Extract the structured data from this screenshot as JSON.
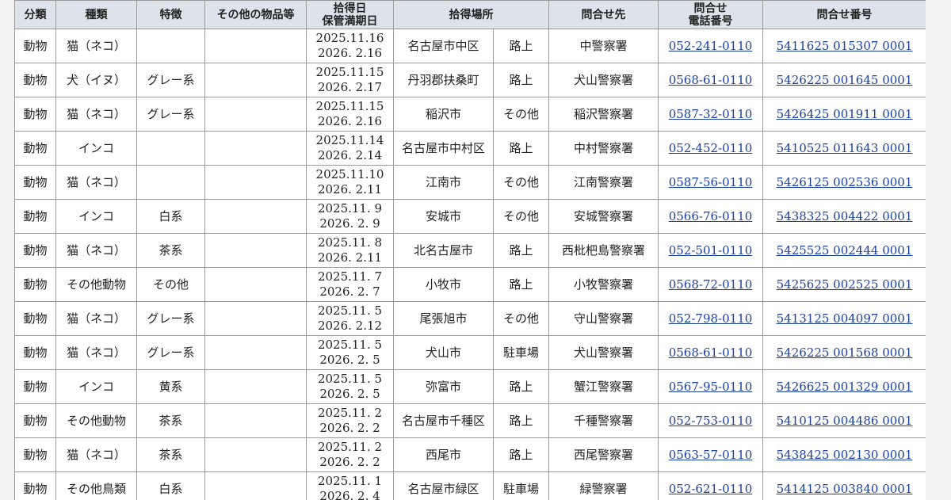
{
  "table": {
    "headers": {
      "category": "分類",
      "kind": "種類",
      "feature": "特徴",
      "other_items": "その他の物品等",
      "date_line1": "拾得日",
      "date_line2": "保管満期日",
      "place": "拾得場所",
      "contact": "問合せ先",
      "phone_line1": "問合せ",
      "phone_line2": "電話番号",
      "inquiry_no": "問合せ番号"
    },
    "rows": [
      {
        "category": "動物",
        "kind": "猫（ネコ）",
        "feature": "",
        "other": "",
        "found": "2025.11.16",
        "expiry": "2026. 2.16",
        "city": "名古屋市中区",
        "spot": "路上",
        "contact": "中警察署",
        "phone": "052-241-0110",
        "inquiry": "5411625 015307 0001"
      },
      {
        "category": "動物",
        "kind": "犬（イヌ）",
        "feature": "グレー系",
        "other": "",
        "found": "2025.11.15",
        "expiry": "2026. 2.17",
        "city": "丹羽郡扶桑町",
        "spot": "路上",
        "contact": "犬山警察署",
        "phone": "0568-61-0110",
        "inquiry": "5426225 001645 0001"
      },
      {
        "category": "動物",
        "kind": "猫（ネコ）",
        "feature": "グレー系",
        "other": "",
        "found": "2025.11.15",
        "expiry": "2026. 2.16",
        "city": "稲沢市",
        "spot": "その他",
        "contact": "稲沢警察署",
        "phone": "0587-32-0110",
        "inquiry": "5426425 001911 0001"
      },
      {
        "category": "動物",
        "kind": "インコ",
        "feature": "",
        "other": "",
        "found": "2025.11.14",
        "expiry": "2026. 2.14",
        "city": "名古屋市中村区",
        "spot": "路上",
        "contact": "中村警察署",
        "phone": "052-452-0110",
        "inquiry": "5410525 011643 0001"
      },
      {
        "category": "動物",
        "kind": "猫（ネコ）",
        "feature": "",
        "other": "",
        "found": "2025.11.10",
        "expiry": "2026. 2.11",
        "city": "江南市",
        "spot": "その他",
        "contact": "江南警察署",
        "phone": "0587-56-0110",
        "inquiry": "5426125 002536 0001"
      },
      {
        "category": "動物",
        "kind": "インコ",
        "feature": "白系",
        "other": "",
        "found": "2025.11. 9",
        "expiry": "2026. 2. 9",
        "city": "安城市",
        "spot": "その他",
        "contact": "安城警察署",
        "phone": "0566-76-0110",
        "inquiry": "5438325 004422 0001"
      },
      {
        "category": "動物",
        "kind": "猫（ネコ）",
        "feature": "茶系",
        "other": "",
        "found": "2025.11. 8",
        "expiry": "2026. 2.11",
        "city": "北名古屋市",
        "spot": "路上",
        "contact": "西枇杷島警察署",
        "phone": "052-501-0110",
        "inquiry": "5425525 002444 0001"
      },
      {
        "category": "動物",
        "kind": "その他動物",
        "feature": "その他",
        "other": "",
        "found": "2025.11. 7",
        "expiry": "2026. 2. 7",
        "city": "小牧市",
        "spot": "路上",
        "contact": "小牧警察署",
        "phone": "0568-72-0110",
        "inquiry": "5425625 002525 0001"
      },
      {
        "category": "動物",
        "kind": "猫（ネコ）",
        "feature": "グレー系",
        "other": "",
        "found": "2025.11. 5",
        "expiry": "2026. 2.12",
        "city": "尾張旭市",
        "spot": "その他",
        "contact": "守山警察署",
        "phone": "052-798-0110",
        "inquiry": "5413125 004097 0001"
      },
      {
        "category": "動物",
        "kind": "猫（ネコ）",
        "feature": "グレー系",
        "other": "",
        "found": "2025.11. 5",
        "expiry": "2026. 2. 5",
        "city": "犬山市",
        "spot": "駐車場",
        "contact": "犬山警察署",
        "phone": "0568-61-0110",
        "inquiry": "5426225 001568 0001"
      },
      {
        "category": "動物",
        "kind": "インコ",
        "feature": "黄系",
        "other": "",
        "found": "2025.11. 5",
        "expiry": "2026. 2. 5",
        "city": "弥富市",
        "spot": "路上",
        "contact": "蟹江警察署",
        "phone": "0567-95-0110",
        "inquiry": "5426625 001329 0001"
      },
      {
        "category": "動物",
        "kind": "その他動物",
        "feature": "茶系",
        "other": "",
        "found": "2025.11. 2",
        "expiry": "2026. 2. 2",
        "city": "名古屋市千種区",
        "spot": "路上",
        "contact": "千種警察署",
        "phone": "052-753-0110",
        "inquiry": "5410125 004486 0001"
      },
      {
        "category": "動物",
        "kind": "猫（ネコ）",
        "feature": "茶系",
        "other": "",
        "found": "2025.11. 2",
        "expiry": "2026. 2. 2",
        "city": "西尾市",
        "spot": "路上",
        "contact": "西尾警察署",
        "phone": "0563-57-0110",
        "inquiry": "5438425 002130 0001"
      },
      {
        "category": "動物",
        "kind": "その他鳥類",
        "feature": "白系",
        "other": "",
        "found": "2025.11. 1",
        "expiry": "2026. 2. 4",
        "city": "名古屋市緑区",
        "spot": "駐車場",
        "contact": "緑警察署",
        "phone": "052-621-0110",
        "inquiry": "5414125 003840 0001"
      }
    ]
  }
}
